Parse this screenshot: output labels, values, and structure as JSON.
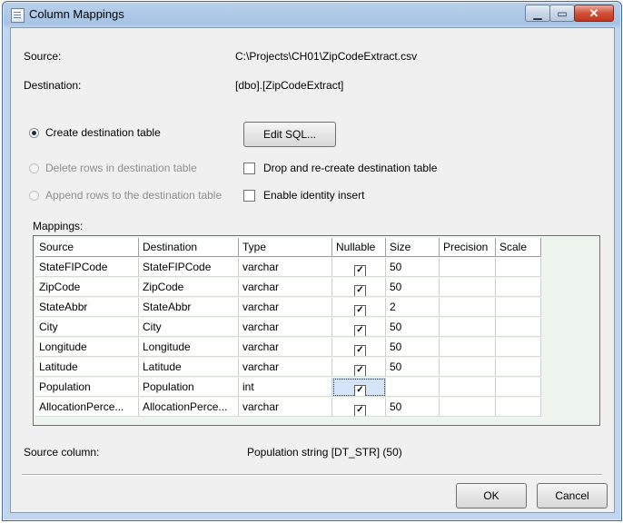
{
  "window": {
    "title": "Column Mappings"
  },
  "info": {
    "source_label": "Source:",
    "source_value": "C:\\Projects\\CH01\\ZipCodeExtract.csv",
    "destination_label": "Destination:",
    "destination_value": "[dbo].[ZipCodeExtract]"
  },
  "options": {
    "create_table": "Create destination table",
    "delete_rows": "Delete rows in destination table",
    "append_rows": "Append rows to the destination table",
    "edit_sql": "Edit SQL...",
    "drop_recreate": "Drop and re-create destination table",
    "identity_insert": "Enable identity insert"
  },
  "mappings": {
    "label": "Mappings:",
    "columns": [
      "Source",
      "Destination",
      "Type",
      "Nullable",
      "Size",
      "Precision",
      "Scale"
    ],
    "rows": [
      {
        "source": "StateFIPCode",
        "destination": "StateFIPCode",
        "type": "varchar",
        "nullable": "✓",
        "size": "50"
      },
      {
        "source": "ZipCode",
        "destination": "ZipCode",
        "type": "varchar",
        "nullable": "✓",
        "size": "50"
      },
      {
        "source": "StateAbbr",
        "destination": "StateAbbr",
        "type": "varchar",
        "nullable": "✓",
        "size": "2"
      },
      {
        "source": "City",
        "destination": "City",
        "type": "varchar",
        "nullable": "✓",
        "size": "50"
      },
      {
        "source": "Longitude",
        "destination": "Longitude",
        "type": "varchar",
        "nullable": "✓",
        "size": "50"
      },
      {
        "source": "Latitude",
        "destination": "Latitude",
        "type": "varchar",
        "nullable": "✓",
        "size": "50"
      },
      {
        "source": "Population",
        "destination": "Population",
        "type": "int",
        "nullable": "✓",
        "size": ""
      },
      {
        "source": "AllocationPerce...",
        "destination": "AllocationPerce...",
        "type": "varchar",
        "nullable": "✓",
        "size": "50"
      }
    ]
  },
  "footer": {
    "source_column_label": "Source column:",
    "source_column_value": "Population string [DT_STR] (50)",
    "ok": "OK",
    "cancel": "Cancel"
  }
}
